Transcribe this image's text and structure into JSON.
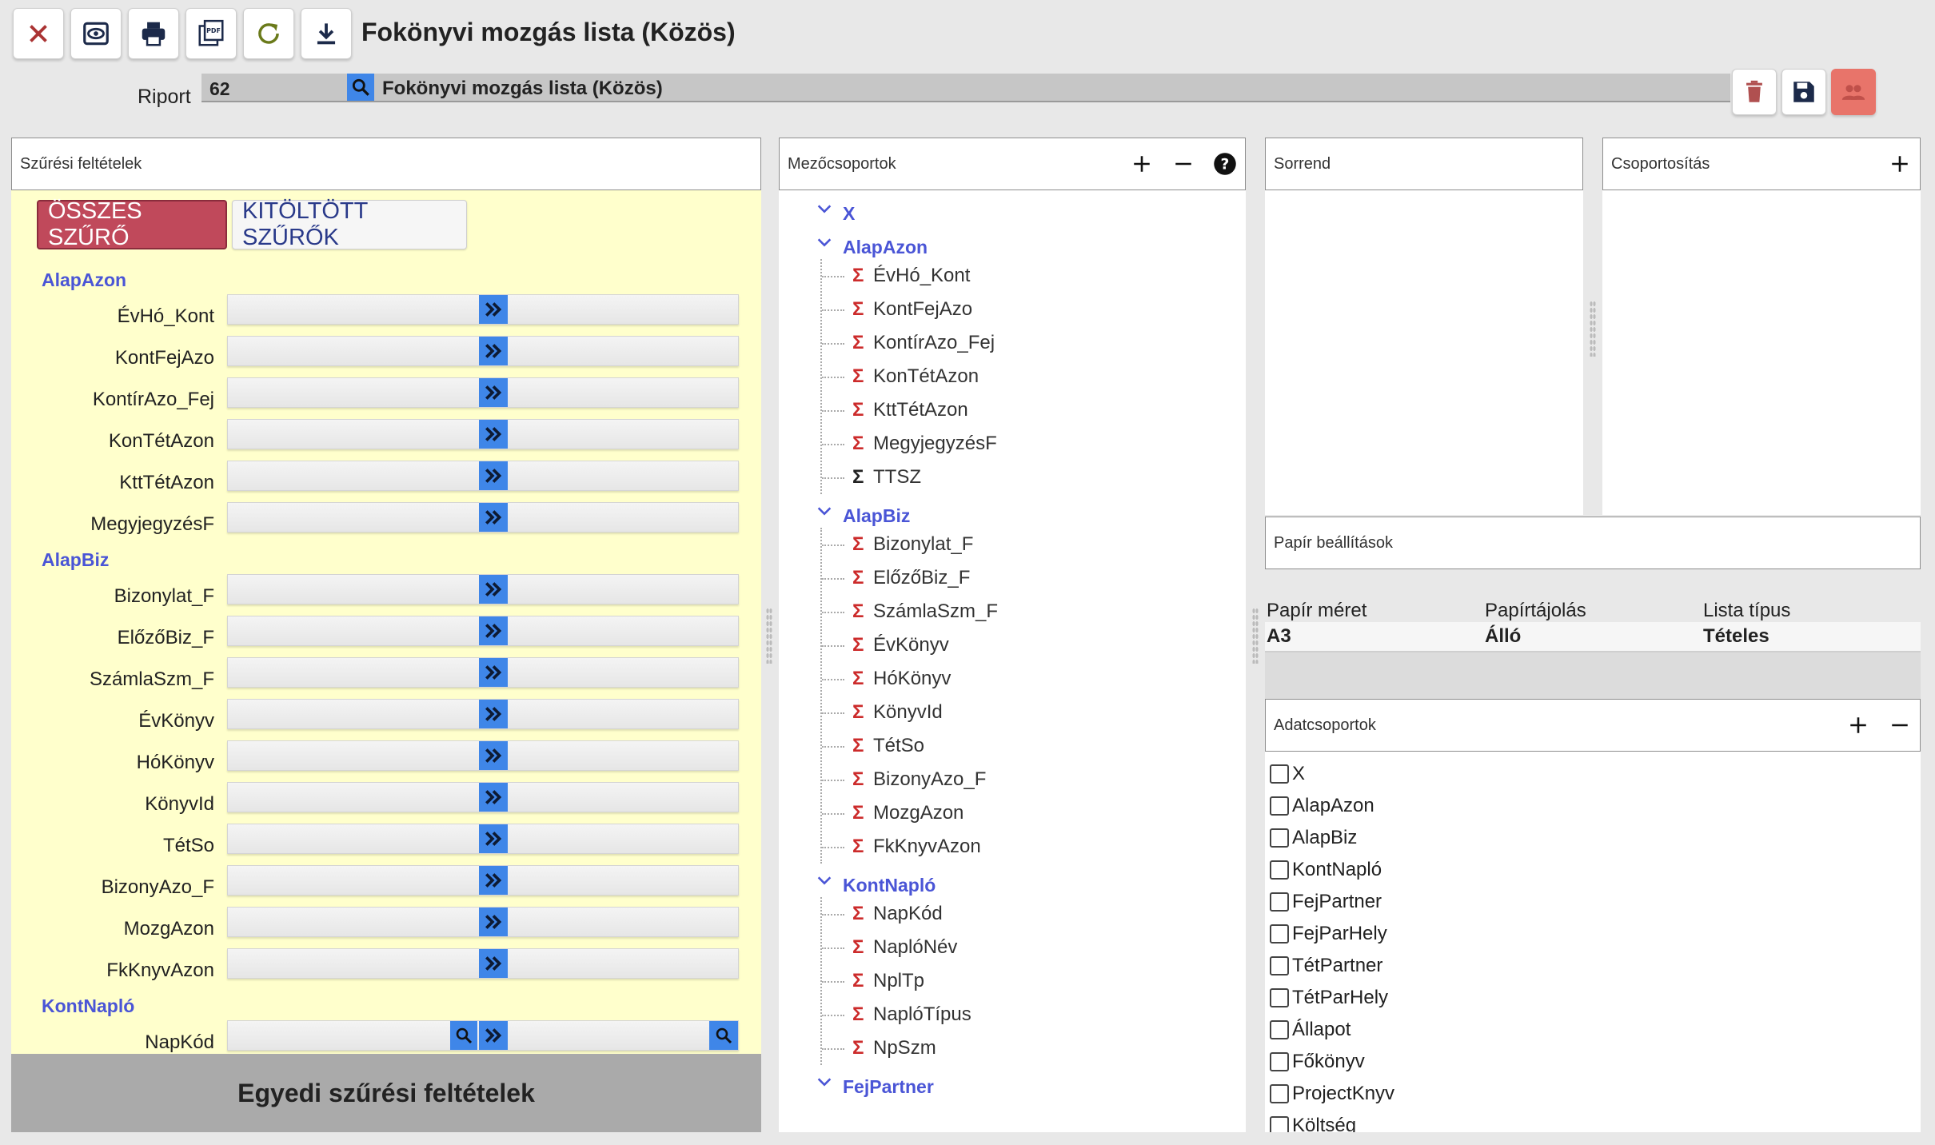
{
  "window": {
    "title": "Fokönyvi mozgás lista (Közös)"
  },
  "toolbar": {
    "buttons": [
      {
        "name": "close-button",
        "icon": "close-icon"
      },
      {
        "name": "preview-button",
        "icon": "eye-icon"
      },
      {
        "name": "print-button",
        "icon": "printer-icon"
      },
      {
        "name": "pdf-button",
        "icon": "pdf-icon"
      },
      {
        "name": "refresh-button",
        "icon": "refresh-icon"
      },
      {
        "name": "download-button",
        "icon": "download-icon"
      }
    ]
  },
  "report": {
    "label": "Riport",
    "id": "62",
    "name": "Fokönyvi  mozgás lista (Közös)"
  },
  "filters": {
    "header": "Szűrési feltételek",
    "tab_all": "ÖSSZES SZŰRŐ",
    "tab_filled": "KITÖLTÖTT SZŰRŐK",
    "groups": [
      {
        "title": "AlapAzon",
        "fields": [
          "ÉvHó_Kont",
          "KontFejAzo",
          "KontírAzo_Fej",
          "KonTétAzon",
          "KttTétAzon",
          "MegyjegyzésF"
        ]
      },
      {
        "title": "AlapBiz",
        "fields": [
          "Bizonylat_F",
          "ElőzőBiz_F",
          "SzámlaSzm_F",
          "ÉvKönyv",
          "HóKönyv",
          "KönyvId",
          "TétSo",
          "BizonyAzo_F",
          "MozgAzon",
          "FkKnyvAzon"
        ]
      },
      {
        "title": "KontNapló",
        "fields": [
          "NapKód"
        ]
      }
    ],
    "custom": "Egyedi szűrési feltételek"
  },
  "field_groups": {
    "header": "Mezőcsoportok",
    "groups": [
      {
        "title": "X",
        "items": []
      },
      {
        "title": "AlapAzon",
        "items": [
          {
            "label": "ÉvHó_Kont",
            "sigma": "red"
          },
          {
            "label": "KontFejAzo",
            "sigma": "red"
          },
          {
            "label": "KontírAzo_Fej",
            "sigma": "red"
          },
          {
            "label": "KonTétAzon",
            "sigma": "red"
          },
          {
            "label": "KttTétAzon",
            "sigma": "red"
          },
          {
            "label": "MegyjegyzésF",
            "sigma": "red"
          },
          {
            "label": "TTSZ",
            "sigma": "black"
          }
        ]
      },
      {
        "title": "AlapBiz",
        "items": [
          {
            "label": "Bizonylat_F",
            "sigma": "red"
          },
          {
            "label": "ElőzőBiz_F",
            "sigma": "red"
          },
          {
            "label": "SzámlaSzm_F",
            "sigma": "red"
          },
          {
            "label": "ÉvKönyv",
            "sigma": "red"
          },
          {
            "label": "HóKönyv",
            "sigma": "red"
          },
          {
            "label": "KönyvId",
            "sigma": "red"
          },
          {
            "label": "TétSo",
            "sigma": "red"
          },
          {
            "label": "BizonyAzo_F",
            "sigma": "red"
          },
          {
            "label": "MozgAzon",
            "sigma": "red"
          },
          {
            "label": "FkKnyvAzon",
            "sigma": "red"
          }
        ]
      },
      {
        "title": "KontNapló",
        "items": [
          {
            "label": "NapKód",
            "sigma": "red"
          },
          {
            "label": "NaplóNév",
            "sigma": "red"
          },
          {
            "label": "NplTp",
            "sigma": "red"
          },
          {
            "label": "NaplóTípus",
            "sigma": "red"
          },
          {
            "label": "NpSzm",
            "sigma": "red"
          }
        ]
      },
      {
        "title": "FejPartner",
        "items": []
      }
    ]
  },
  "order": {
    "header": "Sorrend"
  },
  "grouping": {
    "header": "Csoportosítás"
  },
  "paper": {
    "header": "Papír beállítások",
    "columns": [
      "Papír méret",
      "Papírtájolás",
      "Lista típus"
    ],
    "values": [
      "A3",
      "Álló",
      "Tételes"
    ]
  },
  "data_groups": {
    "header": "Adatcsoportok",
    "items": [
      "X",
      "AlapAzon",
      "AlapBiz",
      "KontNapló",
      "FejPartner",
      "FejParHely",
      "TétPartner",
      "TétParHely",
      "Állapot",
      "Főkönyv",
      "ProjectKnyv",
      "Költség"
    ]
  },
  "colors": {
    "accent_blue": "#3f86e8",
    "group_title": "#4a55d6",
    "tab_active": "#c0495b",
    "filter_bg": "#ffffcc",
    "sigma_red": "#cc2b2b",
    "delete_icon": "#b05050",
    "users_button": "#e8746a"
  }
}
